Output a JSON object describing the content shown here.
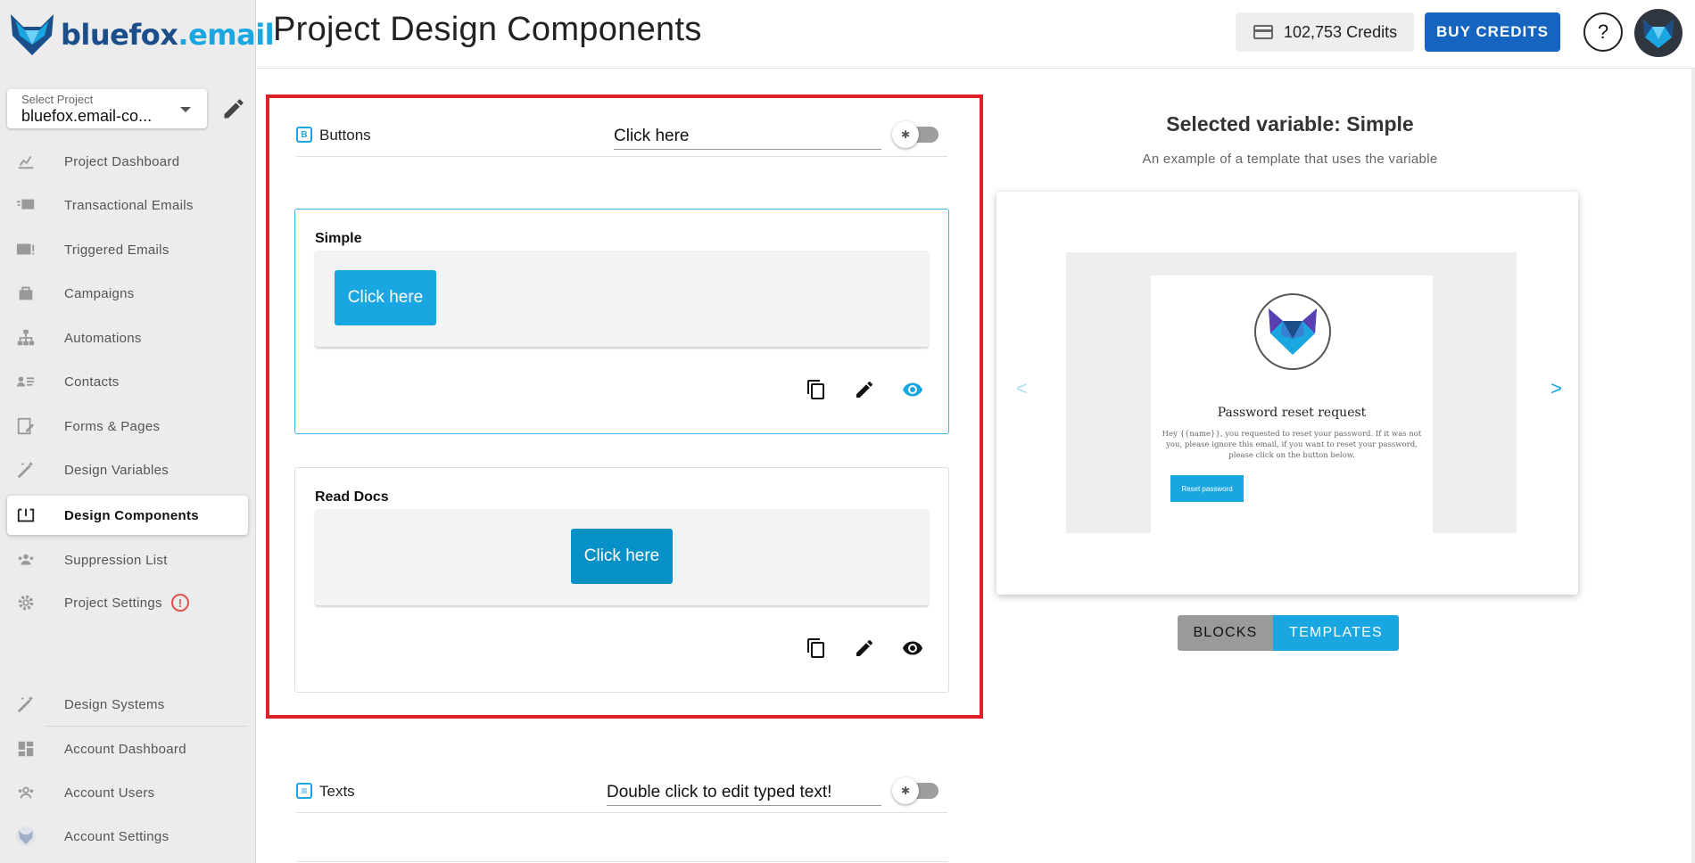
{
  "brand": {
    "name_part1": "bluefox",
    "name_part2": ".email"
  },
  "project_select": {
    "label": "Select Project",
    "value": "bluefox.email-co..."
  },
  "nav": {
    "items": [
      {
        "label": "Project Dashboard",
        "icon": "chart-icon"
      },
      {
        "label": "Transactional Emails",
        "icon": "mail-fast-icon"
      },
      {
        "label": "Triggered Emails",
        "icon": "mail-alert-icon"
      },
      {
        "label": "Campaigns",
        "icon": "campaign-icon"
      },
      {
        "label": "Automations",
        "icon": "sitemap-icon"
      },
      {
        "label": "Contacts",
        "icon": "contacts-icon"
      },
      {
        "label": "Forms & Pages",
        "icon": "form-icon"
      },
      {
        "label": "Design Variables",
        "icon": "magic-wand-icon"
      },
      {
        "label": "Design Components",
        "icon": "component-icon",
        "active": true
      },
      {
        "label": "Suppression List",
        "icon": "group-icon"
      },
      {
        "label": "Project Settings",
        "icon": "gear-icon",
        "warning": "!"
      },
      {
        "label": "Design Systems",
        "icon": "magic-wand-icon"
      },
      {
        "label": "Account Dashboard",
        "icon": "dashboard-icon"
      },
      {
        "label": "Account Users",
        "icon": "users-icon"
      },
      {
        "label": "Account Settings",
        "icon": "fox-icon"
      }
    ]
  },
  "header": {
    "title": "Project Design Components",
    "credits": "102,753 Credits",
    "buy_label": "BUY CREDITS",
    "help_label": "?"
  },
  "sections": {
    "buttons": {
      "title": "Buttons",
      "icon_letter": "B",
      "input_value": "Click here",
      "components": [
        {
          "name": "Simple",
          "button_text": "Click here",
          "button_color": "#1aa6e0",
          "align": "left",
          "selected": true
        },
        {
          "name": "Read Docs",
          "button_text": "Click here",
          "button_color": "#0891c6",
          "align": "center",
          "selected": false
        }
      ]
    },
    "texts": {
      "title": "Texts",
      "input_value": "Double click to edit typed text!"
    }
  },
  "preview": {
    "title": "Selected variable: Simple",
    "subtitle": "An example of a template that uses the variable",
    "email": {
      "heading": "Password reset request",
      "body": "Hey {{name}}, you requested to reset your password. If it was not you, please ignore this email, if you want to reset your password, please click on the button below.",
      "button": "Reset password"
    },
    "prev_arrow": "<",
    "next_arrow": ">",
    "tabs": {
      "blocks": "BLOCKS",
      "templates": "TEMPLATES"
    }
  },
  "colors": {
    "accent": "#1aa6e0",
    "primary": "#1565c0",
    "highlight": "#e3202a",
    "warning": "#e05252"
  }
}
